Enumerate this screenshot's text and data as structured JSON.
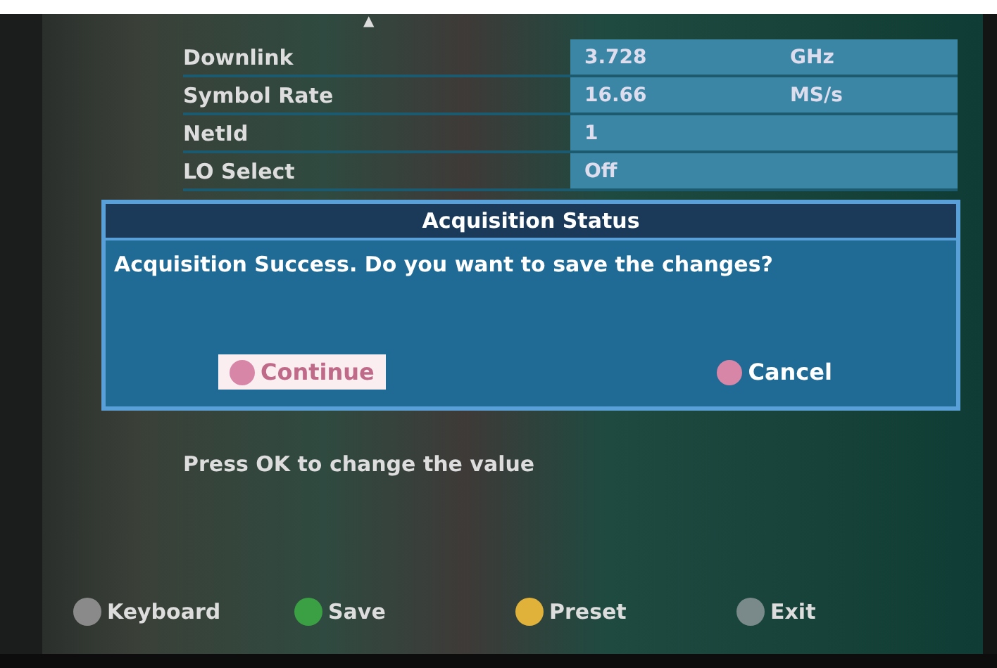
{
  "scroll_up_glyph": "▲",
  "settings": [
    {
      "label": "Downlink",
      "value": "3.728",
      "unit": "GHz"
    },
    {
      "label": "Symbol Rate",
      "value": "16.66",
      "unit": "MS/s"
    },
    {
      "label": "NetId",
      "value": "1"
    },
    {
      "label": "LO Select",
      "value": "Off"
    }
  ],
  "hint": "Press OK to change the value",
  "dialog": {
    "title": "Acquisition Status",
    "message": "Acquisition Success. Do you want to save the changes?",
    "buttons": [
      {
        "label": "Continue",
        "selected": true
      },
      {
        "label": "Cancel",
        "selected": false
      }
    ]
  },
  "footer_keys": [
    {
      "label": "Keyboard",
      "color": "#8a8a8a"
    },
    {
      "label": "Save",
      "color": "#3aa043"
    },
    {
      "label": "Preset",
      "color": "#e0b23a"
    },
    {
      "label": "Exit",
      "color": "#7a8a8a"
    }
  ]
}
